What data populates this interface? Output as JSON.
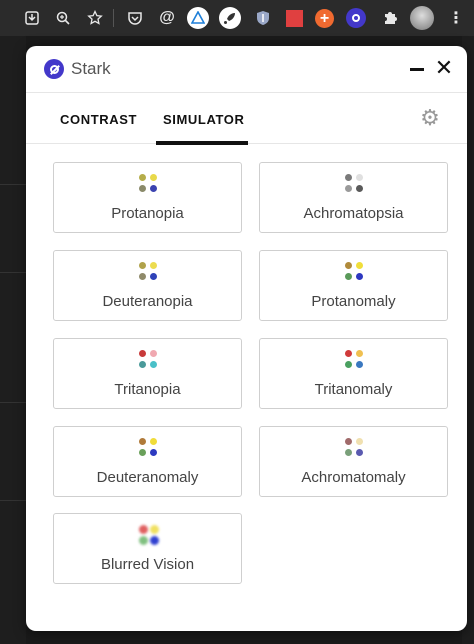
{
  "browser": {
    "toolbar_icons": [
      "download-icon",
      "zoom-icon",
      "bookmark-star-icon",
      "pocket-icon",
      "at-icon",
      "extension-blue-icon",
      "rocket-icon",
      "shield-icon",
      "red-square-icon",
      "plus-orange-icon",
      "stark-icon",
      "puzzle-icon",
      "avatar",
      "more-vert-icon"
    ]
  },
  "app": {
    "title": "Stark",
    "brand_color": "#4338ca"
  },
  "tabs": [
    {
      "label": "CONTRAST",
      "active": false
    },
    {
      "label": "SIMULATOR",
      "active": true
    }
  ],
  "simulators": [
    {
      "label": "Protanopia",
      "colors": [
        "#b5ad4a",
        "#e8d94a",
        "#8a8a6a",
        "#3b43b0"
      ]
    },
    {
      "label": "Achromatopsia",
      "colors": [
        "#7a7a7a",
        "#e0e0e0",
        "#9a9a9a",
        "#5a5a5a"
      ]
    },
    {
      "label": "Deuteranopia",
      "colors": [
        "#b0a24a",
        "#ecdc50",
        "#8f8a6a",
        "#2f42b8"
      ]
    },
    {
      "label": "Protanomaly",
      "colors": [
        "#b08a3a",
        "#f0de3a",
        "#5a9a5a",
        "#2d38c0"
      ]
    },
    {
      "label": "Tritanopia",
      "colors": [
        "#c83a3a",
        "#f0a8b0",
        "#4a9a9a",
        "#4ac0c8"
      ]
    },
    {
      "label": "Tritanomaly",
      "colors": [
        "#d03a3a",
        "#f0c050",
        "#4aa060",
        "#3a78c0"
      ]
    },
    {
      "label": "Deuteranomaly",
      "colors": [
        "#b07a3a",
        "#f0dc3a",
        "#6aa05a",
        "#2d3ac0"
      ]
    },
    {
      "label": "Achromatomaly",
      "colors": [
        "#a06a6a",
        "#f0e0b0",
        "#7aa07a",
        "#5a5ab0"
      ]
    },
    {
      "label": "Blurred Vision",
      "colors": [
        "#e06060",
        "#f0e060",
        "#80c080",
        "#3040d0"
      ],
      "blur": true
    }
  ]
}
